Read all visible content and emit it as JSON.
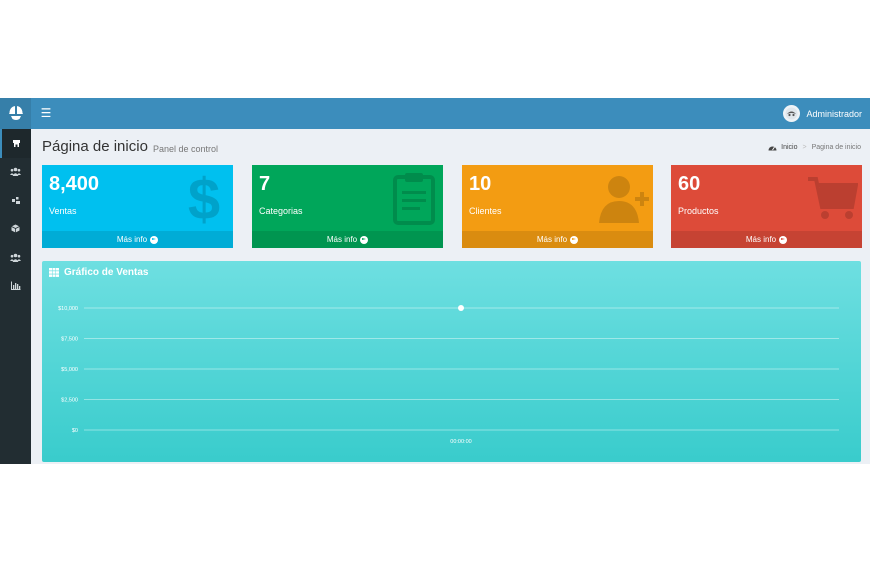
{
  "header": {
    "logo_icon": "helmet-icon",
    "menu_icon": "hamburger-icon",
    "user_name": "Administrador"
  },
  "sidebar": {
    "items": [
      {
        "icon": "home-icon",
        "active": true
      },
      {
        "icon": "users-icon"
      },
      {
        "icon": "categories-icon"
      },
      {
        "icon": "box-icon"
      },
      {
        "icon": "clients-icon"
      },
      {
        "icon": "bar-chart-icon"
      }
    ]
  },
  "page": {
    "title": "Página de inicio",
    "subtitle": "Panel de control",
    "breadcrumb": {
      "home": "Inicio",
      "current": "Pagina de inicio"
    }
  },
  "boxes": [
    {
      "value": "8,400",
      "label": "Ventas",
      "footer": "Más info",
      "color": "#00c0ef",
      "icon": "dollar-icon"
    },
    {
      "value": "7",
      "label": "Categorias",
      "footer": "Más info",
      "color": "#00a65a",
      "icon": "clipboard-icon"
    },
    {
      "value": "10",
      "label": "Clientes",
      "footer": "Más info",
      "color": "#f39c12",
      "icon": "user-plus-icon"
    },
    {
      "value": "60",
      "label": "Productos",
      "footer": "Más info",
      "color": "#dd4b39",
      "icon": "cart-icon"
    }
  ],
  "chart_data": {
    "type": "line",
    "title": "Gráfico de Ventas",
    "x": [
      "00:00:00"
    ],
    "series": [
      {
        "values": [
          10000
        ]
      }
    ],
    "yticks": [
      0,
      2500,
      5000,
      7500,
      10000
    ],
    "ytick_labels": [
      "$0",
      "$2,500",
      "$5,000",
      "$7,500",
      "$10,000"
    ],
    "ylim": [
      0,
      10000
    ],
    "grid": true,
    "background": "#39cccc"
  }
}
